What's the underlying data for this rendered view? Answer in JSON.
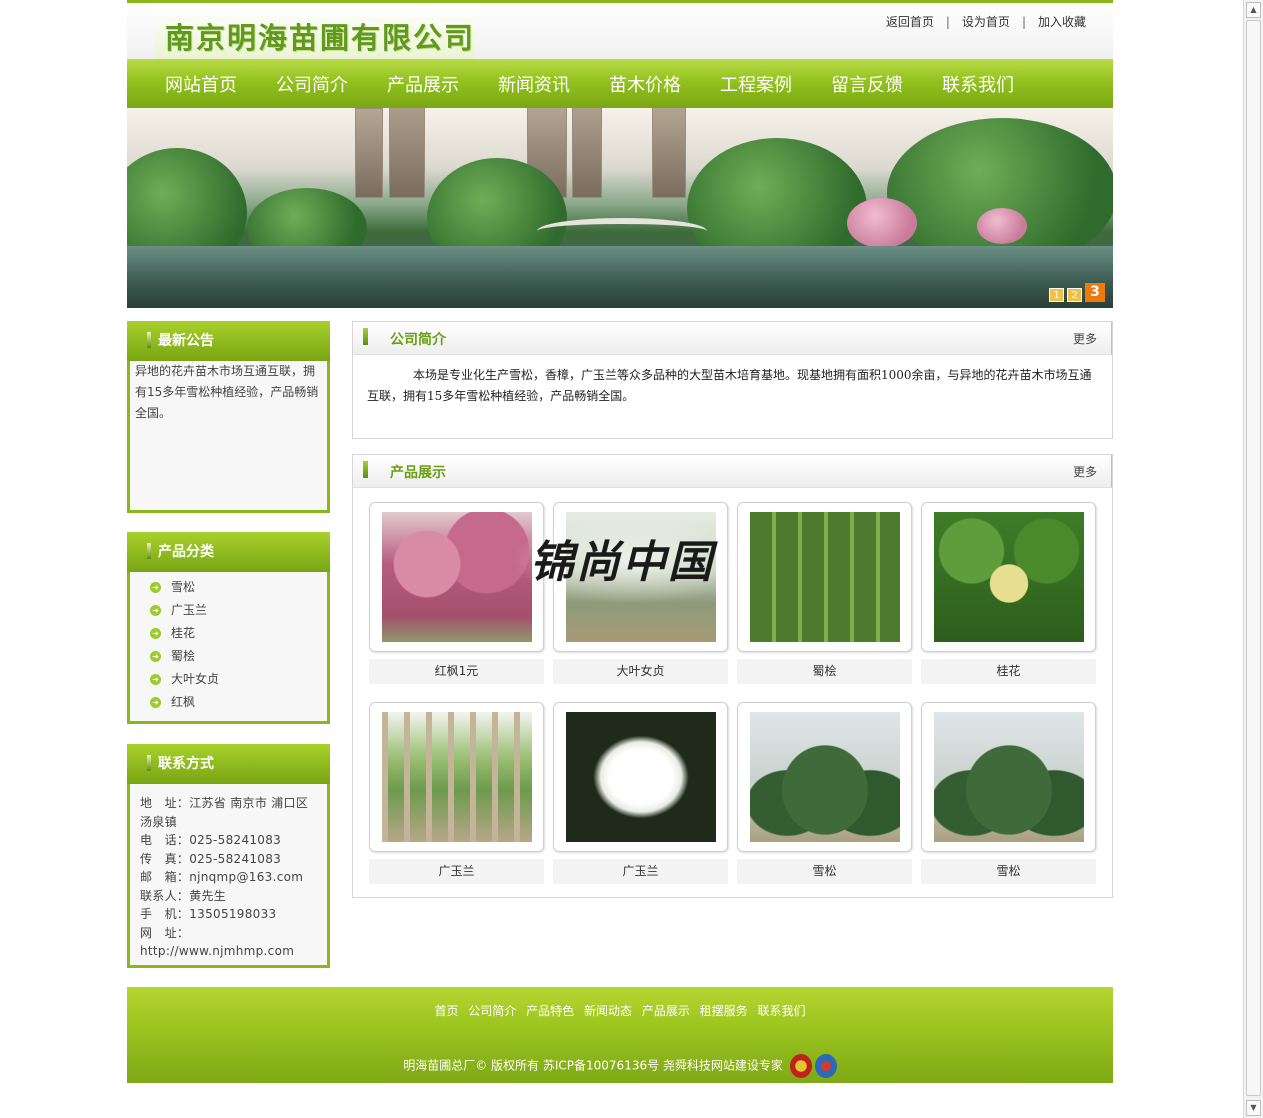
{
  "header": {
    "logo_text": "南京明海苗圃有限公司",
    "top_links": [
      "返回首页",
      "设为首页",
      "加入收藏"
    ]
  },
  "nav": [
    "网站首页",
    "公司简介",
    "产品展示",
    "新闻资讯",
    "苗木价格",
    "工程案例",
    "留言反馈",
    "联系我们"
  ],
  "banner": {
    "pages": [
      "1",
      "2",
      "3"
    ],
    "active_page": "3"
  },
  "notice": {
    "title": "最新公告",
    "text": "异地的花卉苗木市场互通互联，拥有15多年雪松种植经验，产品畅销全国。"
  },
  "categories": {
    "title": "产品分类",
    "items": [
      "雪松",
      "广玉兰",
      "桂花",
      "蜀桧",
      "大叶女贞",
      "红枫"
    ]
  },
  "contact": {
    "title": "联系方式",
    "address": "地　址：江苏省 南京市 浦口区汤泉镇",
    "phone": "电　话：025-58241083",
    "fax": "传　真：025-58241083",
    "email": "邮　箱：njnqmp@163.com",
    "person": "联系人：黄先生",
    "mobile": "手　机：13505198033",
    "website_label": "网　址：",
    "website": "http://www.njmhmp.com"
  },
  "about": {
    "title": "公司简介",
    "more": "更多",
    "text": "本场是专业化生产雪松，香樟，广玉兰等众多品种的大型苗木培育基地。现基地拥有面积1000余亩，与异地的花卉苗木市场互通互联，拥有15多年雪松种植经验，产品畅销全国。"
  },
  "products": {
    "title": "产品展示",
    "more": "更多",
    "items": [
      {
        "name": "红枫1元"
      },
      {
        "name": "大叶女贞"
      },
      {
        "name": "蜀桧"
      },
      {
        "name": "桂花"
      },
      {
        "name": "广玉兰"
      },
      {
        "name": "广玉兰"
      },
      {
        "name": "雪松"
      },
      {
        "name": "雪松"
      }
    ]
  },
  "watermark": "锦尚中国",
  "footer": {
    "links": [
      "首页",
      "公司简介",
      "产品特色",
      "新闻动态",
      "产品展示",
      "租摆服务",
      "联系我们"
    ],
    "copyright": "明海苗圃总厂© 版权所有  苏ICP备10076136号 尧舜科技网站建设专家"
  }
}
